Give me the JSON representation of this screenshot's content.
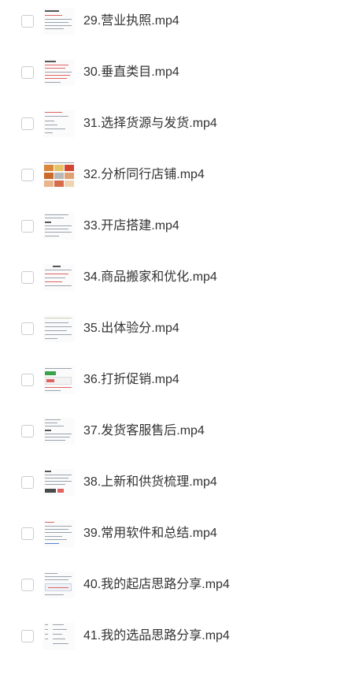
{
  "files": [
    {
      "name": "29.营业执照.mp4",
      "thumb_icon": "document-thumbnail-icon"
    },
    {
      "name": "30.垂直类目.mp4",
      "thumb_icon": "document-thumbnail-icon"
    },
    {
      "name": "31.选择货源与发货.mp4",
      "thumb_icon": "document-thumbnail-icon"
    },
    {
      "name": "32.分析同行店铺.mp4",
      "thumb_icon": "image-grid-thumbnail-icon"
    },
    {
      "name": "33.开店搭建.mp4",
      "thumb_icon": "document-thumbnail-icon"
    },
    {
      "name": "34.商品搬家和优化.mp4",
      "thumb_icon": "document-thumbnail-icon"
    },
    {
      "name": "35.出体验分.mp4",
      "thumb_icon": "document-thumbnail-icon"
    },
    {
      "name": "36.打折促销.mp4",
      "thumb_icon": "screenshot-thumbnail-icon"
    },
    {
      "name": "37.发货客服售后.mp4",
      "thumb_icon": "document-thumbnail-icon"
    },
    {
      "name": "38.上新和供货梳理.mp4",
      "thumb_icon": "document-thumbnail-icon"
    },
    {
      "name": "39.常用软件和总结.mp4",
      "thumb_icon": "document-thumbnail-icon"
    },
    {
      "name": "40.我的起店思路分享.mp4",
      "thumb_icon": "document-thumbnail-icon"
    },
    {
      "name": "41.我的选品思路分享.mp4",
      "thumb_icon": "document-thumbnail-icon"
    }
  ],
  "colors": {
    "checkbox_border": "#c9ccd2",
    "text": "#333333",
    "accent_red": "#e06363"
  }
}
